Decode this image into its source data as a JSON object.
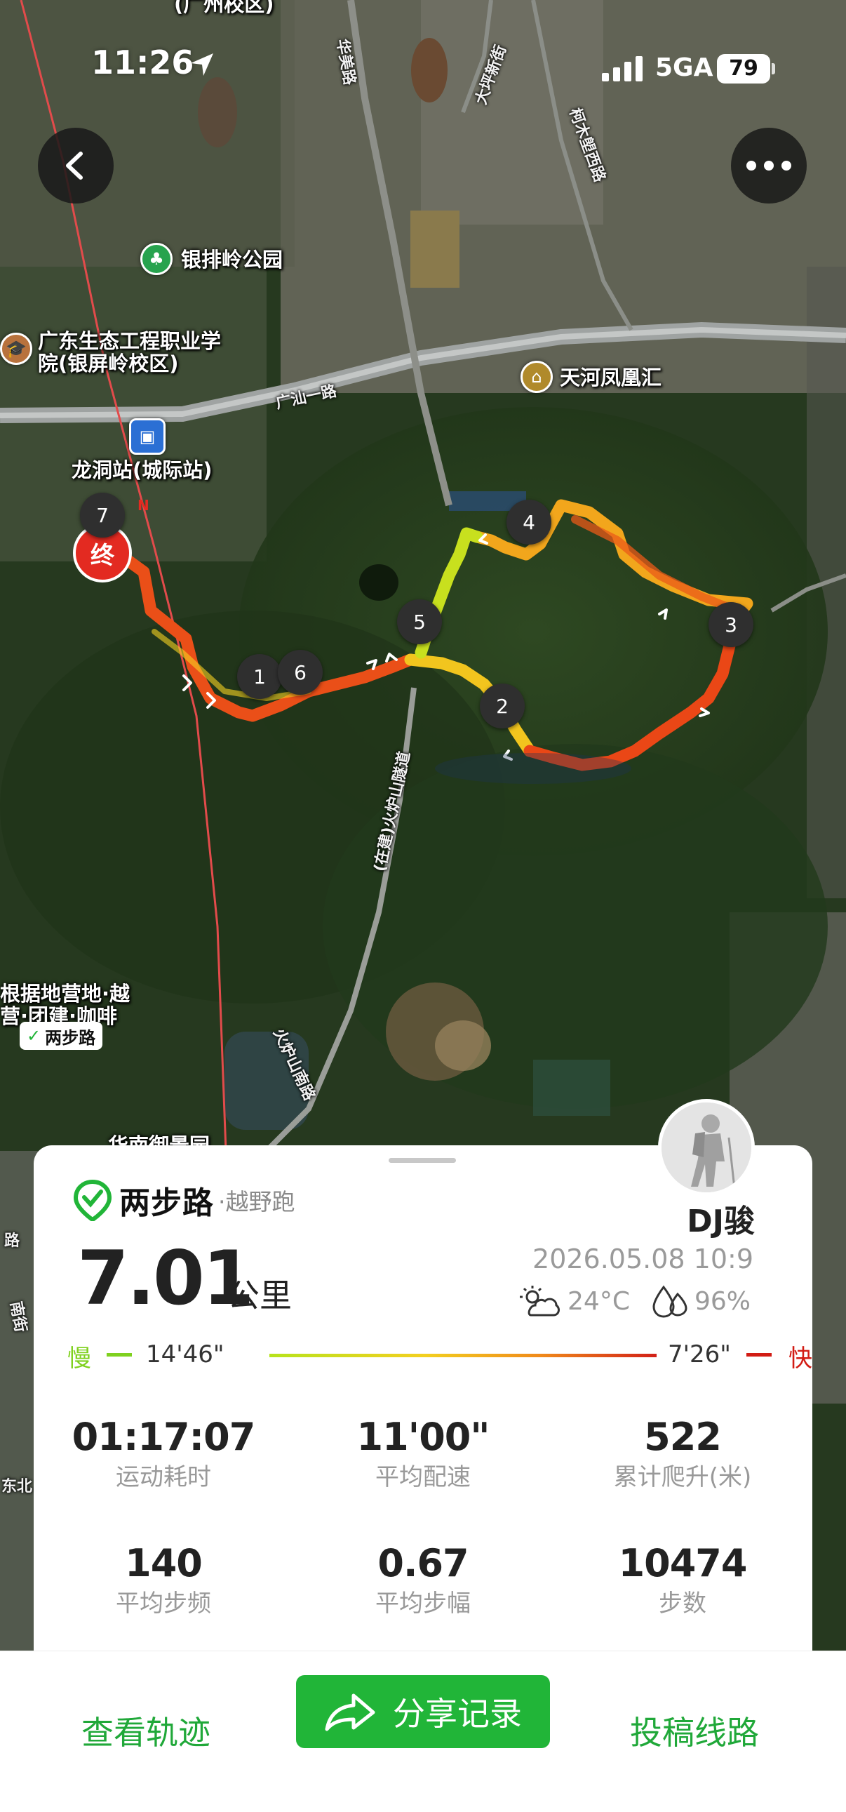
{
  "status_bar": {
    "time": "11:26",
    "network": "5GA",
    "battery": "79"
  },
  "map": {
    "labels": {
      "campus_top": "(广州校区)",
      "park": "银排岭公园",
      "college_line1": "广东生态工程职业学",
      "college_line2": "院(银屏岭校区)",
      "mall": "天河凤凰汇",
      "station": "龙洞站(城际站)",
      "camp_line1": "根据地营地·越",
      "camp_line2": "营·团建·咖啡",
      "camp_brand": "两步路",
      "bottom_poi": "华南御景园",
      "road_guangshan": "广汕一路",
      "road_tunnel": "(在建)火炉山隧道",
      "road_huolu": "火炉山南路",
      "road_huamei": "华美路",
      "road_dakeng": "大坪新街",
      "road_kemu": "柯木塱西路",
      "road_left1": "路",
      "road_left2": "南街",
      "road_left3": "东北"
    },
    "start_end_marker": "终",
    "start_badge": "N",
    "waypoints": [
      "1",
      "2",
      "3",
      "4",
      "5",
      "6",
      "7"
    ]
  },
  "card": {
    "brand": "两步路",
    "activity_type": "·越野跑",
    "username": "DJ骏",
    "distance": "7.01",
    "distance_unit": "公里",
    "date": "2026.05.08 10:9",
    "temperature": "24°C",
    "humidity": "96%",
    "pace_legend": {
      "slow_label": "慢",
      "slow_value": "14'46\"",
      "fast_value": "7'26\"",
      "fast_label": "快",
      "slow_color": "#7fd11f",
      "fast_color": "#d21c14"
    },
    "stats": [
      {
        "value": "01:17:07",
        "label": "运动耗时"
      },
      {
        "value": "11'00\"",
        "label": "平均配速"
      },
      {
        "value": "522",
        "label": "累计爬升(米)"
      },
      {
        "value": "140",
        "label": "平均步频"
      },
      {
        "value": "0.67",
        "label": "平均步幅"
      },
      {
        "value": "10474",
        "label": "步数"
      }
    ]
  },
  "bottom_bar": {
    "view_track": "查看轨迹",
    "share": "分享记录",
    "submit_route": "投稿线路"
  },
  "colors": {
    "accent_green": "#21b538",
    "text_green": "#20a839"
  },
  "icons": [
    "back-icon",
    "more-icon",
    "location-arrow-icon",
    "signal-icon",
    "share-icon",
    "cloud-sun-icon",
    "humidity-icon",
    "tree-icon",
    "school-icon",
    "train-icon",
    "shopping-icon",
    "brand-logo-icon",
    "hiker-avatar"
  ]
}
